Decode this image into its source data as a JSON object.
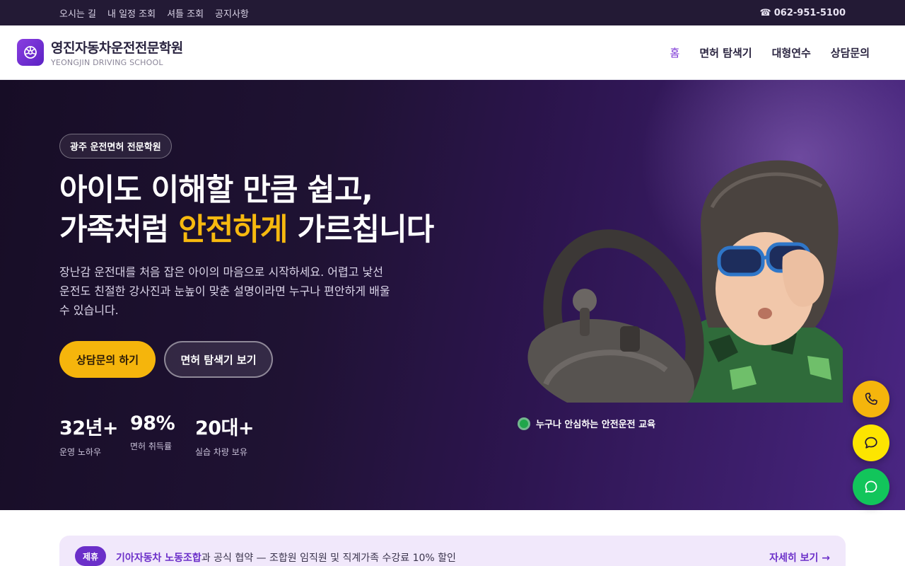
{
  "topbar": {
    "links": [
      "오시는 길",
      "내 일정 조회",
      "셔틀 조회",
      "공지사항"
    ],
    "phone_icon": "☎",
    "phone": "062-951-5100"
  },
  "header": {
    "logo_icon": "steering-wheel-icon",
    "title": "영진자동차운전전문학원",
    "subtitle": "YEONGJIN DRIVING SCHOOL",
    "nav": [
      "홈",
      "면허 탐색기",
      "대형연수",
      "상담문의"
    ],
    "active_nav": "홈"
  },
  "hero": {
    "badge": "광주 운전면허 전문학원",
    "title_line1": "아이도 이해할 만큼 쉽고,",
    "title_line2_pre": "가족처럼 ",
    "title_line2_highlight": "안전하게",
    "title_line2_post": " 가르칩니다",
    "description": "장난감 운전대를 처음 잡은 아이의 마음으로 시작하세요. 어렵고 낯선 운전도 친절한 강사진과 눈높이 맞춘 설명이라면 누구나 편안하게 배울 수 있습니다.",
    "primary_button": "상담문의 하기",
    "secondary_button": "면허 탐색기 보기",
    "stats": [
      {
        "value": "32년+",
        "label": "운영 노하우"
      },
      {
        "value": "98%",
        "label": "면허 취득률"
      },
      {
        "value": "20대+",
        "label": "실습 차량 보유"
      }
    ],
    "image_caption": "누구나 안심하는 안전운전 교육"
  },
  "fabs": {
    "phone_icon": "phone-icon",
    "kakao_icon": "chat-bubble-icon",
    "talk_icon": "message-icon"
  },
  "partner": {
    "tag": "제휴",
    "strong": "기아자동차 노동조합",
    "text": "과 공식 협약 — 조합원 임직원 및 직계가족 수강료 10% 할인",
    "more": "자세히 보기 →"
  },
  "colors": {
    "accent": "#7b35d6",
    "highlight": "#f7b90f",
    "hero_bg": "#1f1233",
    "topbar_bg": "#231a35"
  }
}
